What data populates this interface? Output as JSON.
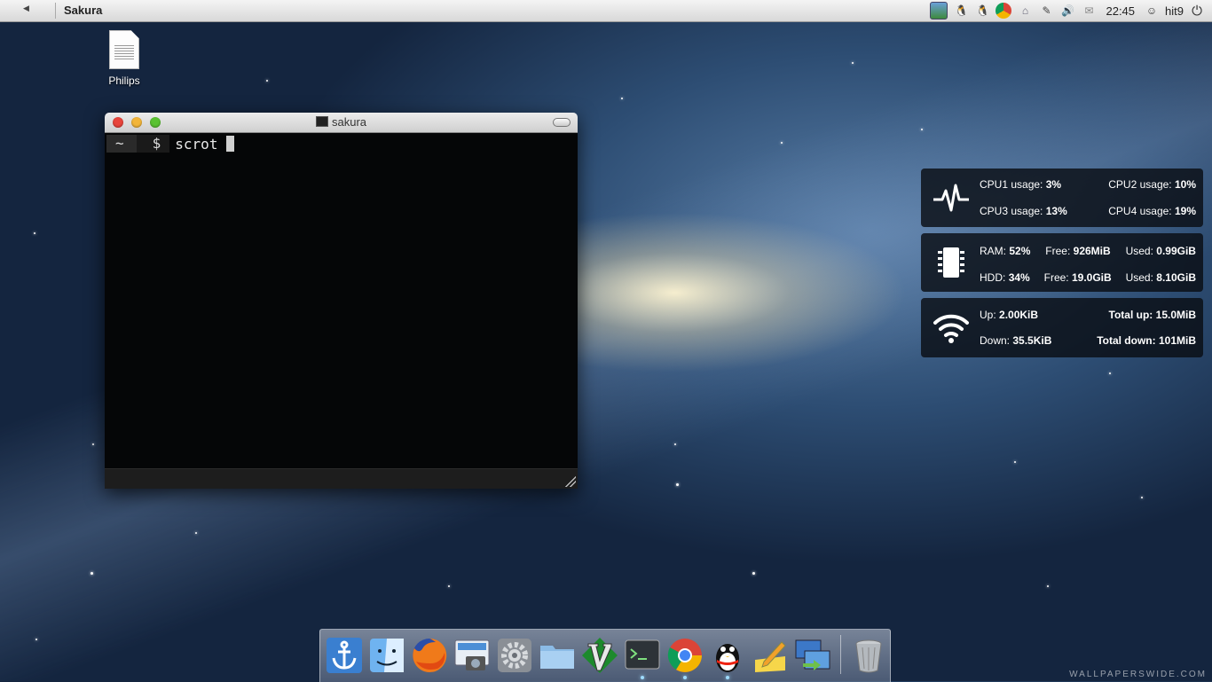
{
  "top_panel": {
    "title": "Sakura",
    "clock": "22:45",
    "user": "hit9",
    "tray_icons": [
      "image-viewer-icon",
      "qq-icon",
      "qq-icon",
      "chrome-icon",
      "network-icon",
      "pen-icon",
      "volume-icon",
      "mail-icon"
    ]
  },
  "desktop": {
    "icon_label": "Philips"
  },
  "terminal": {
    "title": "sakura",
    "prompt_dir": "~",
    "prompt_symbol": "$",
    "command": "scrot"
  },
  "widgets": {
    "cpu": {
      "cpu1_label": "CPU1 usage:",
      "cpu1_value": "3%",
      "cpu2_label": "CPU2 usage:",
      "cpu2_value": "10%",
      "cpu3_label": "CPU3 usage:",
      "cpu3_value": "13%",
      "cpu4_label": "CPU4 usage:",
      "cpu4_value": "19%"
    },
    "mem": {
      "ram_label": "RAM:",
      "ram_value": "52%",
      "ram_free_label": "Free:",
      "ram_free_value": "926MiB",
      "ram_used_label": "Used:",
      "ram_used_value": "0.99GiB",
      "hdd_label": "HDD:",
      "hdd_value": "34%",
      "hdd_free_label": "Free:",
      "hdd_free_value": "19.0GiB",
      "hdd_used_label": "Used:",
      "hdd_used_value": "8.10GiB"
    },
    "net": {
      "up_label": "Up:",
      "up_value": "2.00KiB",
      "total_up_label": "Total up:",
      "total_up_value": "15.0MiB",
      "down_label": "Down:",
      "down_value": "35.5KiB",
      "total_down_label": "Total down:",
      "total_down_value": "101MiB"
    }
  },
  "dock": {
    "items": [
      "anchor-icon",
      "finder-icon",
      "firefox-icon",
      "screenshot-icon",
      "settings-icon",
      "folder-icon",
      "vim-icon",
      "terminal-icon",
      "chrome-icon",
      "qq-icon",
      "editor-icon",
      "remote-desktop-icon",
      "trash-icon"
    ]
  },
  "watermark": "WALLPAPERSWIDE.COM"
}
